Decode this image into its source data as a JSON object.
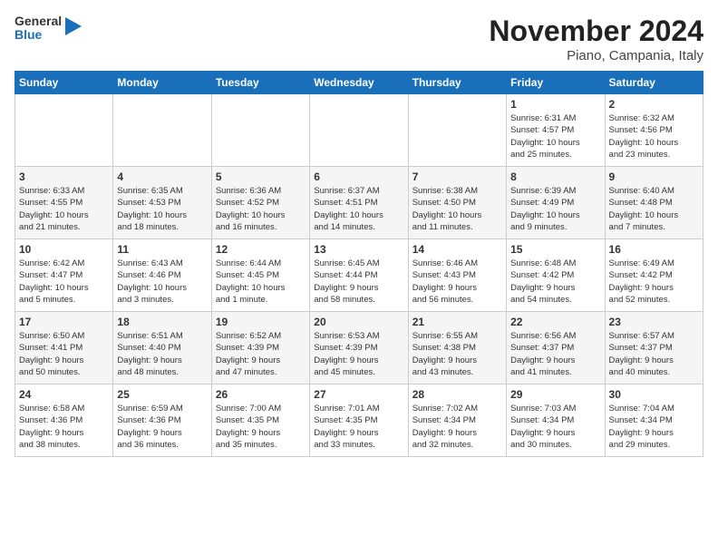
{
  "logo": {
    "general": "General",
    "blue": "Blue"
  },
  "title": "November 2024",
  "subtitle": "Piano, Campania, Italy",
  "days_of_week": [
    "Sunday",
    "Monday",
    "Tuesday",
    "Wednesday",
    "Thursday",
    "Friday",
    "Saturday"
  ],
  "weeks": [
    [
      {
        "day": "",
        "info": ""
      },
      {
        "day": "",
        "info": ""
      },
      {
        "day": "",
        "info": ""
      },
      {
        "day": "",
        "info": ""
      },
      {
        "day": "",
        "info": ""
      },
      {
        "day": "1",
        "info": "Sunrise: 6:31 AM\nSunset: 4:57 PM\nDaylight: 10 hours\nand 25 minutes."
      },
      {
        "day": "2",
        "info": "Sunrise: 6:32 AM\nSunset: 4:56 PM\nDaylight: 10 hours\nand 23 minutes."
      }
    ],
    [
      {
        "day": "3",
        "info": "Sunrise: 6:33 AM\nSunset: 4:55 PM\nDaylight: 10 hours\nand 21 minutes."
      },
      {
        "day": "4",
        "info": "Sunrise: 6:35 AM\nSunset: 4:53 PM\nDaylight: 10 hours\nand 18 minutes."
      },
      {
        "day": "5",
        "info": "Sunrise: 6:36 AM\nSunset: 4:52 PM\nDaylight: 10 hours\nand 16 minutes."
      },
      {
        "day": "6",
        "info": "Sunrise: 6:37 AM\nSunset: 4:51 PM\nDaylight: 10 hours\nand 14 minutes."
      },
      {
        "day": "7",
        "info": "Sunrise: 6:38 AM\nSunset: 4:50 PM\nDaylight: 10 hours\nand 11 minutes."
      },
      {
        "day": "8",
        "info": "Sunrise: 6:39 AM\nSunset: 4:49 PM\nDaylight: 10 hours\nand 9 minutes."
      },
      {
        "day": "9",
        "info": "Sunrise: 6:40 AM\nSunset: 4:48 PM\nDaylight: 10 hours\nand 7 minutes."
      }
    ],
    [
      {
        "day": "10",
        "info": "Sunrise: 6:42 AM\nSunset: 4:47 PM\nDaylight: 10 hours\nand 5 minutes."
      },
      {
        "day": "11",
        "info": "Sunrise: 6:43 AM\nSunset: 4:46 PM\nDaylight: 10 hours\nand 3 minutes."
      },
      {
        "day": "12",
        "info": "Sunrise: 6:44 AM\nSunset: 4:45 PM\nDaylight: 10 hours\nand 1 minute."
      },
      {
        "day": "13",
        "info": "Sunrise: 6:45 AM\nSunset: 4:44 PM\nDaylight: 9 hours\nand 58 minutes."
      },
      {
        "day": "14",
        "info": "Sunrise: 6:46 AM\nSunset: 4:43 PM\nDaylight: 9 hours\nand 56 minutes."
      },
      {
        "day": "15",
        "info": "Sunrise: 6:48 AM\nSunset: 4:42 PM\nDaylight: 9 hours\nand 54 minutes."
      },
      {
        "day": "16",
        "info": "Sunrise: 6:49 AM\nSunset: 4:42 PM\nDaylight: 9 hours\nand 52 minutes."
      }
    ],
    [
      {
        "day": "17",
        "info": "Sunrise: 6:50 AM\nSunset: 4:41 PM\nDaylight: 9 hours\nand 50 minutes."
      },
      {
        "day": "18",
        "info": "Sunrise: 6:51 AM\nSunset: 4:40 PM\nDaylight: 9 hours\nand 48 minutes."
      },
      {
        "day": "19",
        "info": "Sunrise: 6:52 AM\nSunset: 4:39 PM\nDaylight: 9 hours\nand 47 minutes."
      },
      {
        "day": "20",
        "info": "Sunrise: 6:53 AM\nSunset: 4:39 PM\nDaylight: 9 hours\nand 45 minutes."
      },
      {
        "day": "21",
        "info": "Sunrise: 6:55 AM\nSunset: 4:38 PM\nDaylight: 9 hours\nand 43 minutes."
      },
      {
        "day": "22",
        "info": "Sunrise: 6:56 AM\nSunset: 4:37 PM\nDaylight: 9 hours\nand 41 minutes."
      },
      {
        "day": "23",
        "info": "Sunrise: 6:57 AM\nSunset: 4:37 PM\nDaylight: 9 hours\nand 40 minutes."
      }
    ],
    [
      {
        "day": "24",
        "info": "Sunrise: 6:58 AM\nSunset: 4:36 PM\nDaylight: 9 hours\nand 38 minutes."
      },
      {
        "day": "25",
        "info": "Sunrise: 6:59 AM\nSunset: 4:36 PM\nDaylight: 9 hours\nand 36 minutes."
      },
      {
        "day": "26",
        "info": "Sunrise: 7:00 AM\nSunset: 4:35 PM\nDaylight: 9 hours\nand 35 minutes."
      },
      {
        "day": "27",
        "info": "Sunrise: 7:01 AM\nSunset: 4:35 PM\nDaylight: 9 hours\nand 33 minutes."
      },
      {
        "day": "28",
        "info": "Sunrise: 7:02 AM\nSunset: 4:34 PM\nDaylight: 9 hours\nand 32 minutes."
      },
      {
        "day": "29",
        "info": "Sunrise: 7:03 AM\nSunset: 4:34 PM\nDaylight: 9 hours\nand 30 minutes."
      },
      {
        "day": "30",
        "info": "Sunrise: 7:04 AM\nSunset: 4:34 PM\nDaylight: 9 hours\nand 29 minutes."
      }
    ]
  ]
}
